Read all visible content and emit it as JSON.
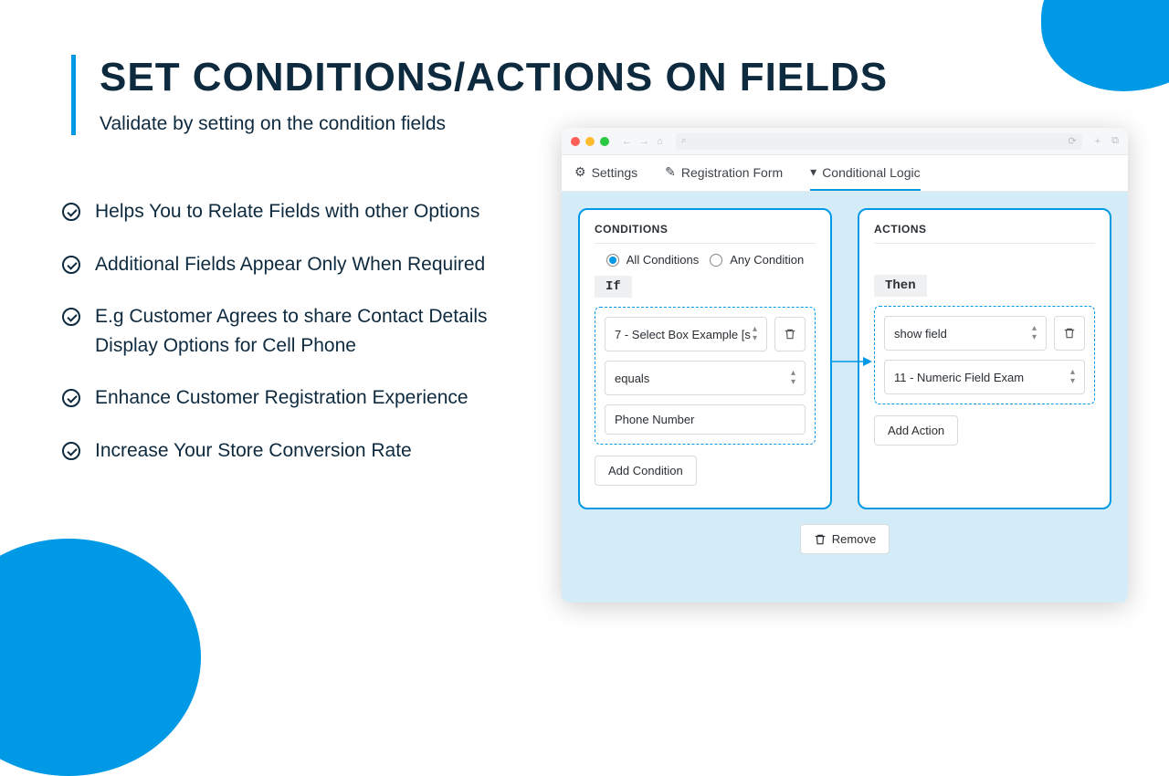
{
  "title": "SET CONDITIONS/ACTIONS ON FIELDS",
  "subtitle": "Validate by setting on the condition fields",
  "bullets": [
    "Helps You to Relate Fields with other Options",
    "Additional Fields Appear Only When Required",
    "E.g Customer Agrees to share Contact Details Display Options for Cell Phone",
    "Enhance Customer Registration Experience",
    "Increase Your Store Conversion Rate"
  ],
  "window": {
    "tabs": {
      "settings": "Settings",
      "registration": "Registration Form",
      "conditional": "Conditional Logic"
    },
    "conditions": {
      "heading": "CONDITIONS",
      "radio_all": "All Conditions",
      "radio_any": "Any Condition",
      "if_tag": "If",
      "field_select": "7 - Select Box Example [s",
      "operator_select": "equals",
      "value_input": "Phone Number",
      "add_btn": "Add Condition"
    },
    "actions": {
      "heading": "ACTIONS",
      "then_tag": "Then",
      "action_select": "show field",
      "target_select": "11 - Numeric Field Exam",
      "add_btn": "Add Action"
    },
    "remove_btn": "Remove"
  }
}
